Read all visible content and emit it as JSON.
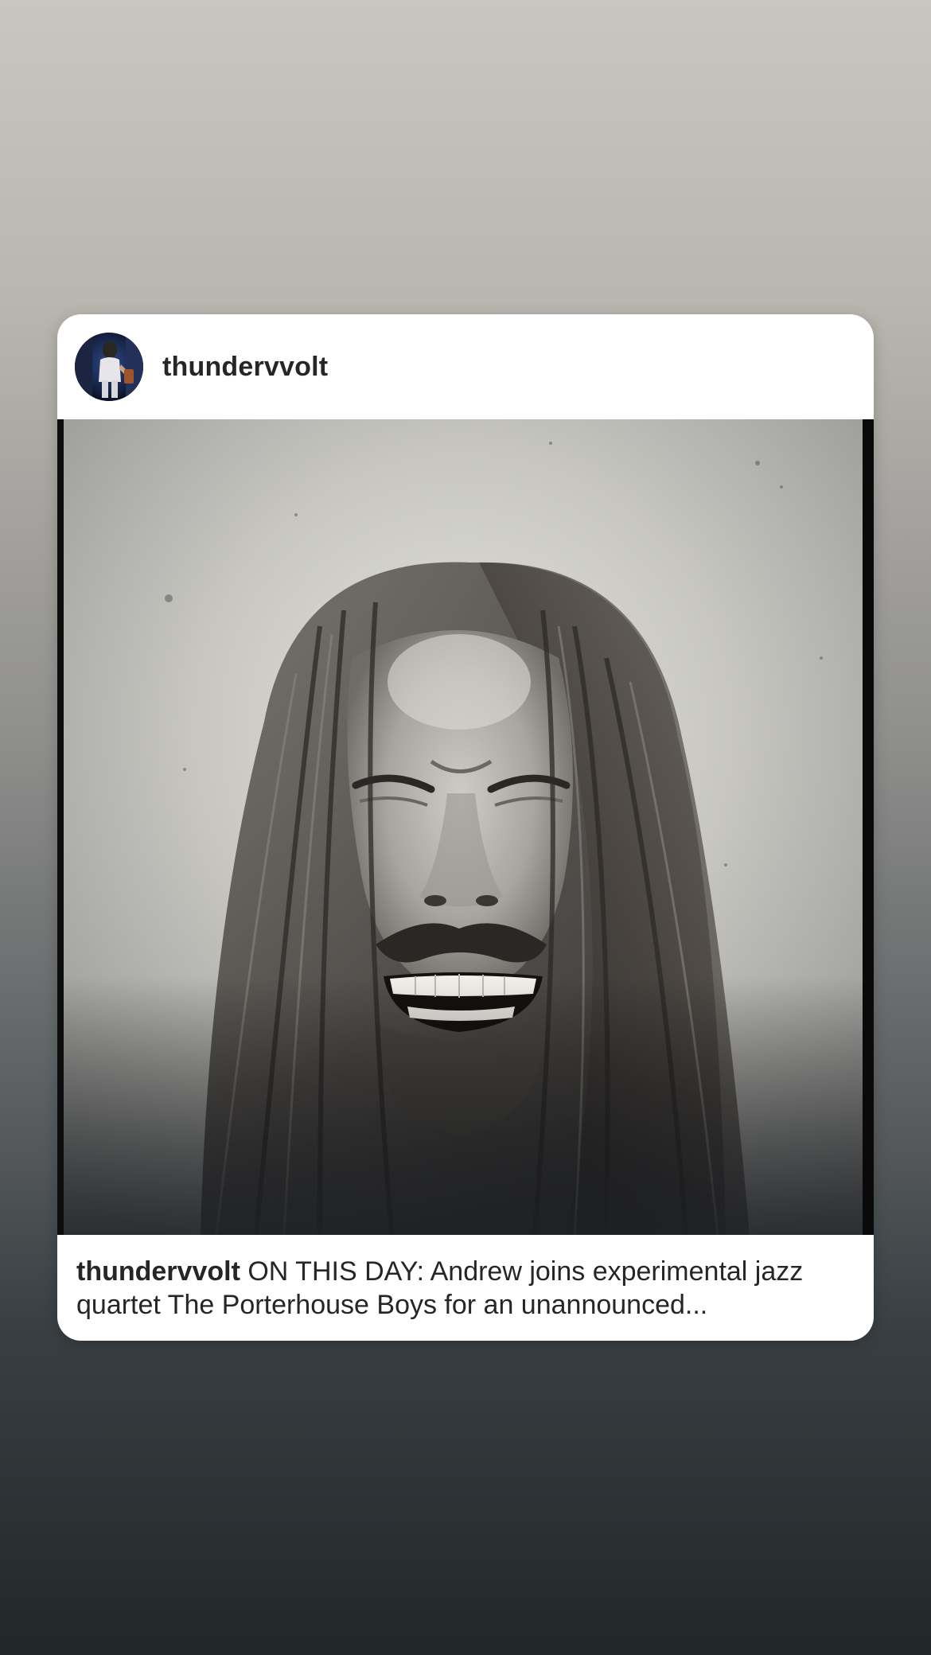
{
  "post": {
    "username": "thundervvolt",
    "avatar_icon": "profile-photo-avatar",
    "photo_icon": "black-and-white-portrait-photo",
    "caption": {
      "username": "thundervvolt",
      "text": " ON THIS DAY: Andrew joins experimental jazz quartet The Porterhouse Boys for an unannounced..."
    }
  },
  "colors": {
    "card_background": "#ffffff",
    "text": "#262626",
    "background_top": "#c9c6c0",
    "background_bottom": "#212729"
  }
}
